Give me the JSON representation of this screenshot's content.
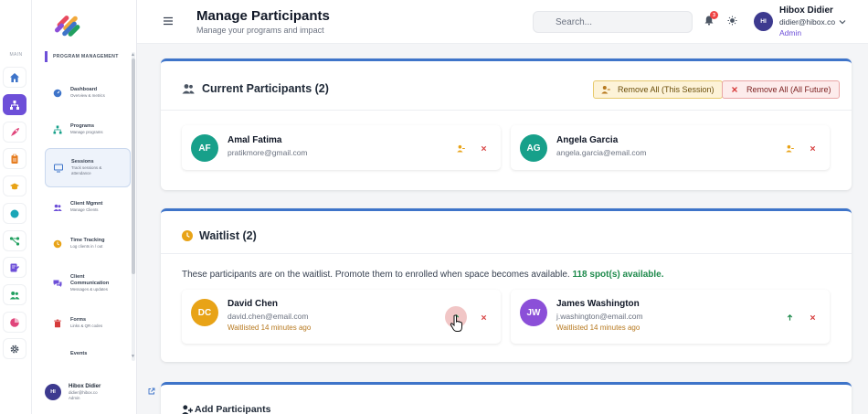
{
  "rail": {
    "label": "MAIN",
    "items": [
      {
        "icon": "home-icon",
        "color": "#3e74c9"
      },
      {
        "icon": "hierarchy-icon",
        "color": "#ffffff",
        "active": true
      },
      {
        "icon": "rocket-icon",
        "color": "#e0457b"
      },
      {
        "icon": "clipboard-icon",
        "color": "#e67e22"
      },
      {
        "icon": "graduation-cap-icon",
        "color": "#e8a317"
      },
      {
        "icon": "circle-icon",
        "color": "#1aa6b7"
      },
      {
        "icon": "flow-icon",
        "color": "#22a060"
      },
      {
        "icon": "edit-doc-icon",
        "color": "#6d4fd8"
      },
      {
        "icon": "users-icon",
        "color": "#22a060"
      },
      {
        "icon": "pie-chart-icon",
        "color": "#e0457b"
      },
      {
        "icon": "gear-icon",
        "color": "#4b5563"
      }
    ]
  },
  "nav": {
    "heading": "PROGRAM MANAGEMENT",
    "items": [
      {
        "title": "Dashboard",
        "sub": "Overview & metrics",
        "icon": "dashboard-icon"
      },
      {
        "title": "Programs",
        "sub": "Manage programs",
        "icon": "hierarchy-icon"
      },
      {
        "title": "Sessions",
        "sub": "Track sessions & attendance",
        "icon": "monitor-icon",
        "active": true
      },
      {
        "title": "Client Mgmnt",
        "sub": "Manage Clients",
        "icon": "users-icon"
      },
      {
        "title": "Time Tracking",
        "sub": "Log clients in / out",
        "icon": "clock-icon"
      },
      {
        "title": "Client Communication",
        "sub": "Messages & updates",
        "icon": "chat-icon"
      },
      {
        "title": "Forms",
        "sub": "Links & QR codes",
        "icon": "trash-icon"
      },
      {
        "title": "Events",
        "sub": "",
        "icon": ""
      }
    ],
    "user": {
      "initials": "HI",
      "name": "Hibox Didier",
      "email": "didier@hibox.co",
      "role": "Admin"
    }
  },
  "header": {
    "title": "Manage Participants",
    "subtitle": "Manage your programs and impact",
    "search_placeholder": "Search...",
    "notification_count": "3",
    "user": {
      "initials": "HI",
      "name": "Hibox Didier",
      "email": "didier@hibox.co",
      "role": "Admin"
    }
  },
  "current": {
    "title": "Current Participants (2)",
    "remove_session": "Remove All (This Session)",
    "remove_future": "Remove All (All Future)",
    "participants": [
      {
        "initials": "AF",
        "name": "Amal Fatima",
        "email": "pratikmore@gmail.com"
      },
      {
        "initials": "AG",
        "name": "Angela Garcia",
        "email": "angela.garcia@email.com"
      }
    ]
  },
  "waitlist": {
    "title": "Waitlist (2)",
    "note": "These participants are on the waitlist. Promote them to enrolled when space becomes available.",
    "spots": "118 spot(s) available.",
    "participants": [
      {
        "initials": "DC",
        "name": "David Chen",
        "email": "david.chen@email.com",
        "status": "Waitlisted 14 minutes ago"
      },
      {
        "initials": "JW",
        "name": "James Washington",
        "email": "j.washington@email.com",
        "status": "Waitlisted 14 minutes ago"
      }
    ]
  },
  "add": {
    "title": "Add Participants"
  },
  "colors": {
    "accent": "#6d4fd8",
    "blue": "#3e74c9",
    "teal": "#17a08a",
    "orange": "#e8a317",
    "purple": "#8b4fd8",
    "danger": "#d63b3b",
    "success": "#1e8a4c"
  }
}
